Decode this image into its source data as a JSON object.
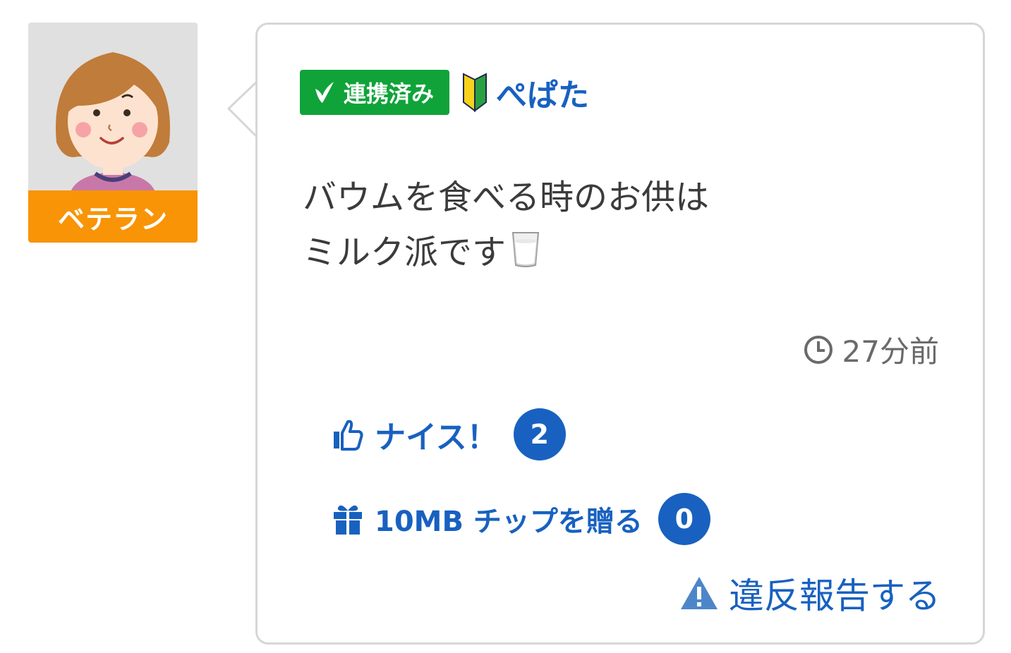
{
  "user": {
    "rank_label": "ベテラン",
    "linked_label": "連携済み",
    "username": "ぺぱた"
  },
  "post": {
    "line1": "バウムを食べる時のお供は",
    "line2": "ミルク派です",
    "time": "27分前"
  },
  "actions": {
    "nice_label": "ナイス！",
    "nice_count": "2",
    "tip_label": "10MB チップを贈る",
    "tip_count": "0",
    "report_label": "違反報告する"
  },
  "colors": {
    "accent_blue": "#1861c0",
    "linked_green": "#10a33a",
    "rank_orange": "#f89406"
  }
}
